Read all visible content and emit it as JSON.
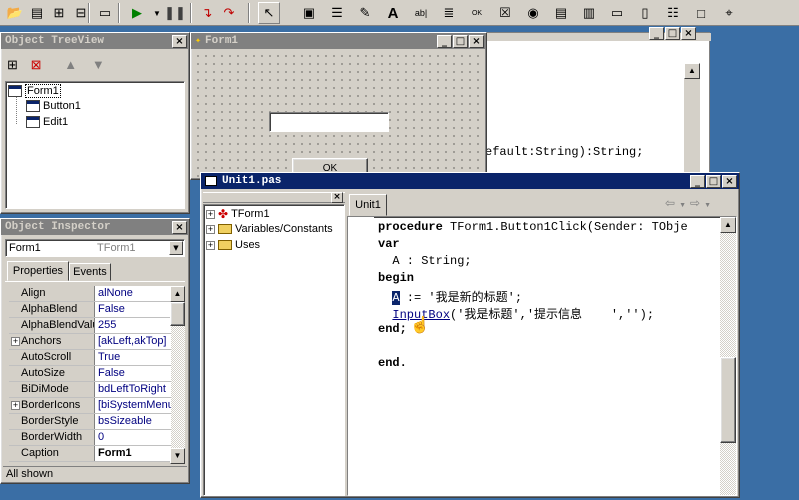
{
  "tree_view": {
    "title": "Object TreeView",
    "nodes": [
      "Form1",
      "Button1",
      "Edit1"
    ]
  },
  "inspector": {
    "title": "Object Inspector",
    "object_name": "Form1",
    "object_type": "TForm1",
    "tabs": [
      "Properties",
      "Events"
    ],
    "properties": [
      {
        "name": "Align",
        "value": "alNone"
      },
      {
        "name": "AlphaBlend",
        "value": "False"
      },
      {
        "name": "AlphaBlendValu",
        "value": "255"
      },
      {
        "name": "Anchors",
        "value": "[akLeft,akTop]"
      },
      {
        "name": "AutoScroll",
        "value": "True"
      },
      {
        "name": "AutoSize",
        "value": "False"
      },
      {
        "name": "BiDiMode",
        "value": "bdLeftToRight"
      },
      {
        "name": "BorderIcons",
        "value": "[biSystemMenu,"
      },
      {
        "name": "BorderStyle",
        "value": "bsSizeable"
      },
      {
        "name": "BorderWidth",
        "value": "0"
      },
      {
        "name": "Caption",
        "value": "Form1"
      }
    ],
    "status": "All shown"
  },
  "form1": {
    "title": "Form1",
    "button_partial": "OK"
  },
  "editor_back": {
    "code_fragment": "efault:String):String;"
  },
  "unit1": {
    "title": "Unit1.pas",
    "tab": "Unit1",
    "explorer": [
      "TForm1",
      "Variables/Constants",
      "Uses"
    ],
    "code": {
      "line1_kw": "procedure",
      "line1_rest": " TForm1.Button1Click(Sender: TObje",
      "line2": "var",
      "line3": "  A : String;",
      "line4": "begin",
      "line5_var": "A",
      "line5_rest": " := '我是新的标题';",
      "line6_fn": "InputBox",
      "line6_rest": "('我是标题','提示信息    ','');",
      "line7": "end;",
      "line9": "end."
    }
  },
  "colors": {
    "desktop": "#3a6ea5",
    "active_title": "#0a246a",
    "inactive_title": "#808080",
    "value_text": "#000080"
  }
}
